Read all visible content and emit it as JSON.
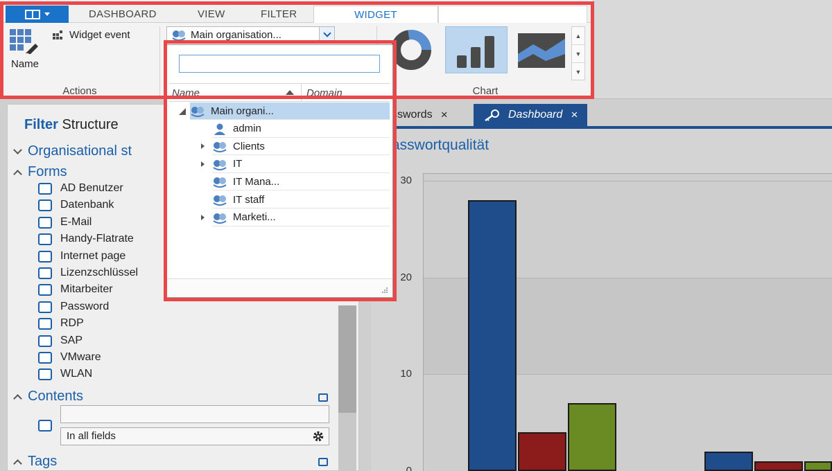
{
  "ribbon": {
    "tabs": [
      {
        "label": "DASHBOARD",
        "active": false
      },
      {
        "label": "VIEW",
        "active": false
      },
      {
        "label": "FILTER",
        "active": false
      },
      {
        "label": "WIDGET",
        "active": true
      }
    ],
    "actions_group": {
      "name_label": "Name",
      "widget_event_label": "Widget event",
      "group_label": "Actions"
    },
    "org_combo_value": "Main organisation...",
    "chart_group": {
      "group_label": "Chart",
      "types": [
        "donut-chart-icon",
        "bar-chart-icon",
        "area-chart-icon"
      ],
      "selected": "bar-chart-icon"
    }
  },
  "dropdown": {
    "search_value": "",
    "columns": [
      "Name",
      "Domain"
    ],
    "rows": [
      {
        "label": "Main organi...",
        "icon": "organisation-icon",
        "expander": "expanded",
        "indent": 0,
        "selected": true
      },
      {
        "label": "admin",
        "icon": "user-icon",
        "expander": "none",
        "indent": 1,
        "selected": false
      },
      {
        "label": "Clients",
        "icon": "organisation-icon",
        "expander": "collapsed",
        "indent": 1,
        "selected": false
      },
      {
        "label": "IT",
        "icon": "organisation-icon",
        "expander": "collapsed",
        "indent": 1,
        "selected": false
      },
      {
        "label": "IT Mana...",
        "icon": "organisation-icon",
        "expander": "none",
        "indent": 1,
        "selected": false
      },
      {
        "label": "IT staff",
        "icon": "organisation-icon",
        "expander": "none",
        "indent": 1,
        "selected": false
      },
      {
        "label": "Marketi...",
        "icon": "organisation-icon",
        "expander": "collapsed",
        "indent": 1,
        "selected": false
      }
    ]
  },
  "filter_panel": {
    "title_bold": "Filter",
    "title_rest": "Structure",
    "organisational_label": "Organisational st",
    "forms_label": "Forms",
    "forms": [
      "AD Benutzer",
      "Datenbank",
      "E-Mail",
      "Handy-Flatrate",
      "Internet page",
      "Lizenzschlüssel",
      "Mitarbeiter",
      "Password",
      "RDP",
      "SAP",
      "VMware",
      "WLAN"
    ],
    "contents_label": "Contents",
    "contents_input_value": "",
    "contents_scope": "In all fields",
    "tags_label": "Tags"
  },
  "document_tabs": [
    {
      "label": "sswords",
      "active": false,
      "icon": ""
    },
    {
      "label": "Dashboard",
      "active": true,
      "icon": "key-icon"
    }
  ],
  "dashboard": {
    "widget_title": "asswortqualität"
  },
  "chart_data": {
    "type": "bar",
    "title": "",
    "xlabel": "",
    "ylabel": "",
    "ylim": [
      0,
      30
    ],
    "y_ticks": [
      "30",
      "20",
      "10",
      "0"
    ],
    "categories": [
      "",
      ""
    ],
    "series": [
      {
        "values": [
          28,
          2
        ],
        "color": "#1f4d8c"
      },
      {
        "values": [
          4,
          1
        ],
        "color": "#8c1c1c"
      },
      {
        "values": [
          7,
          1
        ],
        "color": "#6a8a24"
      }
    ]
  },
  "colors": {
    "accent": "#1a72c9",
    "highlight_frame": "#e8484a",
    "dark_tab": "#1f4f8f"
  }
}
